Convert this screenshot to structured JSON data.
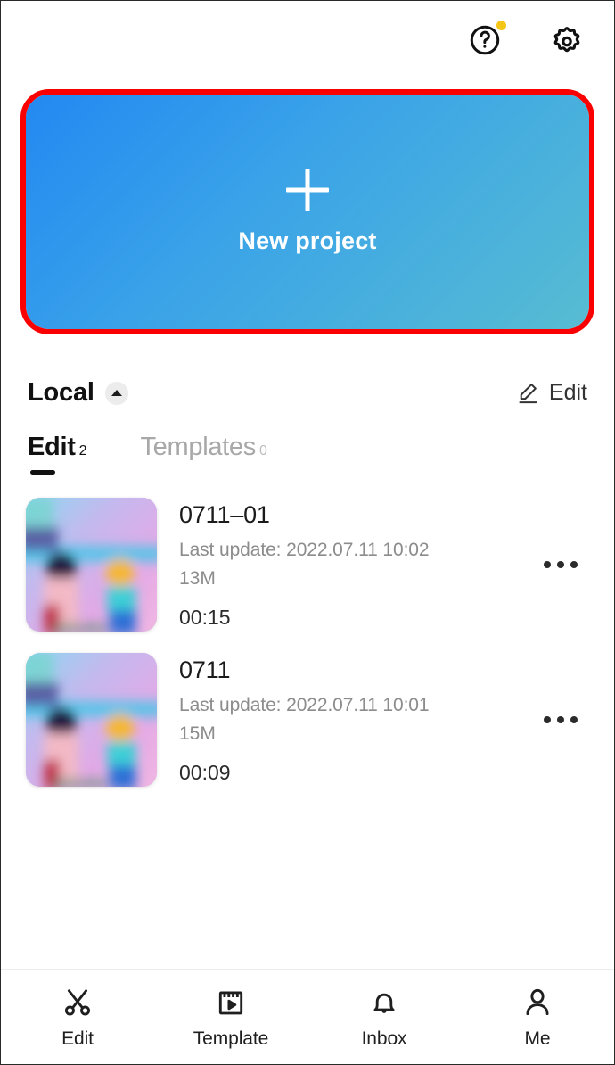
{
  "header": {
    "help_icon": "help-circle-icon",
    "settings_icon": "gear-icon",
    "has_notification_dot": true,
    "notification_dot_color": "#f5c518"
  },
  "new_project": {
    "label": "New project",
    "plus_icon": "plus-icon",
    "gradient_start": "#2389f2",
    "gradient_end": "#57bcd2",
    "highlight_color": "#fb0000"
  },
  "local_section": {
    "title": "Local",
    "collapse_icon": "caret-up-icon",
    "edit_action_label": "Edit",
    "edit_action_icon": "pencil-icon"
  },
  "tabs": [
    {
      "label": "Edit",
      "count": "2",
      "active": true
    },
    {
      "label": "Templates",
      "count": "0",
      "active": false
    }
  ],
  "projects": [
    {
      "title": "0711–01",
      "last_update": "Last update: 2022.07.11 10:02",
      "size": "13M",
      "duration": "00:15",
      "more_icon": "more-horizontal-icon"
    },
    {
      "title": "0711",
      "last_update": "Last update: 2022.07.11 10:01",
      "size": "15M",
      "duration": "00:09",
      "more_icon": "more-horizontal-icon"
    }
  ],
  "bottom_nav": [
    {
      "label": "Edit",
      "icon": "scissors-icon"
    },
    {
      "label": "Template",
      "icon": "clapperboard-play-icon"
    },
    {
      "label": "Inbox",
      "icon": "bell-icon"
    },
    {
      "label": "Me",
      "icon": "person-icon"
    }
  ]
}
